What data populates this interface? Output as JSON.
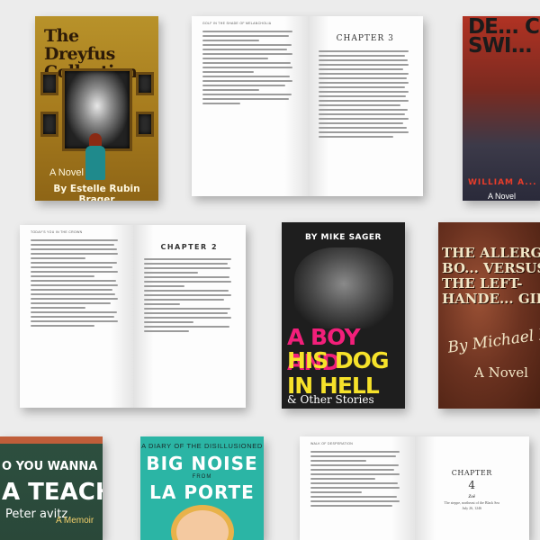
{
  "books": {
    "dreyfus": {
      "title": "The Dreyfus Collection",
      "subtitle": "A Novel",
      "author": "By Estelle Rubin Brager"
    },
    "devils": {
      "title": "DE... C... SWI...",
      "author": "WILLIAM A...",
      "subtitle": "A Novel"
    },
    "boydog": {
      "author": "BY MIKE SAGER",
      "title_line1": "A BOY AND",
      "title_line2": "HIS DOG IN HELL",
      "subtitle": "& Other Stories"
    },
    "allergic": {
      "title": "THE ALLERGIC BO... VERSUS THE LEFT-HANDE... GIRL",
      "author": "By Michael Ku...",
      "subtitle": "A Novel"
    },
    "teacher": {
      "title_small": "O YOU WANNA BE",
      "title_big": "A TEACHER",
      "author": "Peter avitz",
      "subtitle": "A Memoir"
    },
    "bignoise": {
      "kicker": "A DIARY OF THE DISILLUSIONED",
      "title_line1": "BIG NOISE",
      "from": "FROM",
      "title_line2": "LA PORTE"
    }
  },
  "spreads": {
    "ch3": {
      "left_runhead": "GOLF IN THE SHADE OF MELANCHOLIA",
      "chapter": "CHAPTER 3"
    },
    "ch2": {
      "left_runhead": "TODAY'S YOU IN THE CROWN",
      "chapter": "CHAPTER 2"
    },
    "ch4": {
      "left_runhead": "WALK OF DESPERATION",
      "chapter": "CHAPTER",
      "number": "4",
      "name": "Zoë",
      "place": "The steppe, northeast of the Black Sea",
      "date": "July 26, 1246"
    }
  }
}
